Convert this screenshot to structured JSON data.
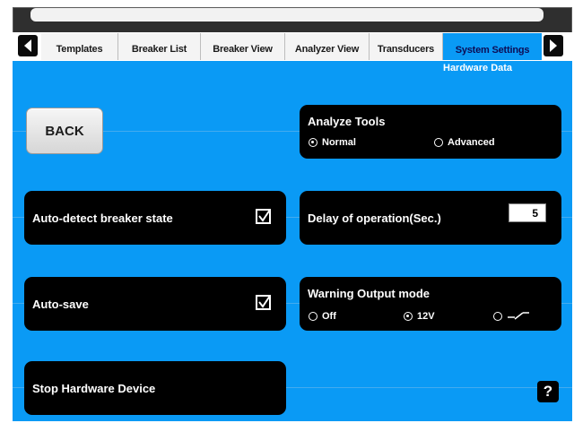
{
  "tabs": [
    {
      "label": "Templates"
    },
    {
      "label": "Breaker List"
    },
    {
      "label": "Breaker View"
    },
    {
      "label": "Analyzer View"
    },
    {
      "label": "Transducers"
    },
    {
      "label": "System Settings"
    }
  ],
  "active_tab": "System Settings",
  "sub_label": "Hardware Data",
  "back_label": "BACK",
  "analyze_tools": {
    "title": "Analyze Tools",
    "options": [
      {
        "label": "Normal",
        "selected": true
      },
      {
        "label": "Advanced",
        "selected": false
      }
    ]
  },
  "auto_detect": {
    "label": "Auto-detect breaker state",
    "checked": true
  },
  "delay": {
    "label": "Delay of operation(Sec.)",
    "value": "5"
  },
  "auto_save": {
    "label": "Auto-save",
    "checked": true
  },
  "warning_output": {
    "title": "Warning Output mode",
    "options": [
      {
        "label": "Off",
        "selected": false
      },
      {
        "label": "12V",
        "selected": true
      },
      {
        "label": "",
        "icon": "contact-switch-icon",
        "selected": false
      }
    ]
  },
  "stop_label": "Stop Hardware Device",
  "help_label": "?",
  "colors": {
    "background": "#0a9af5",
    "panel": "#000000",
    "active_tab": "#0a9af5"
  }
}
